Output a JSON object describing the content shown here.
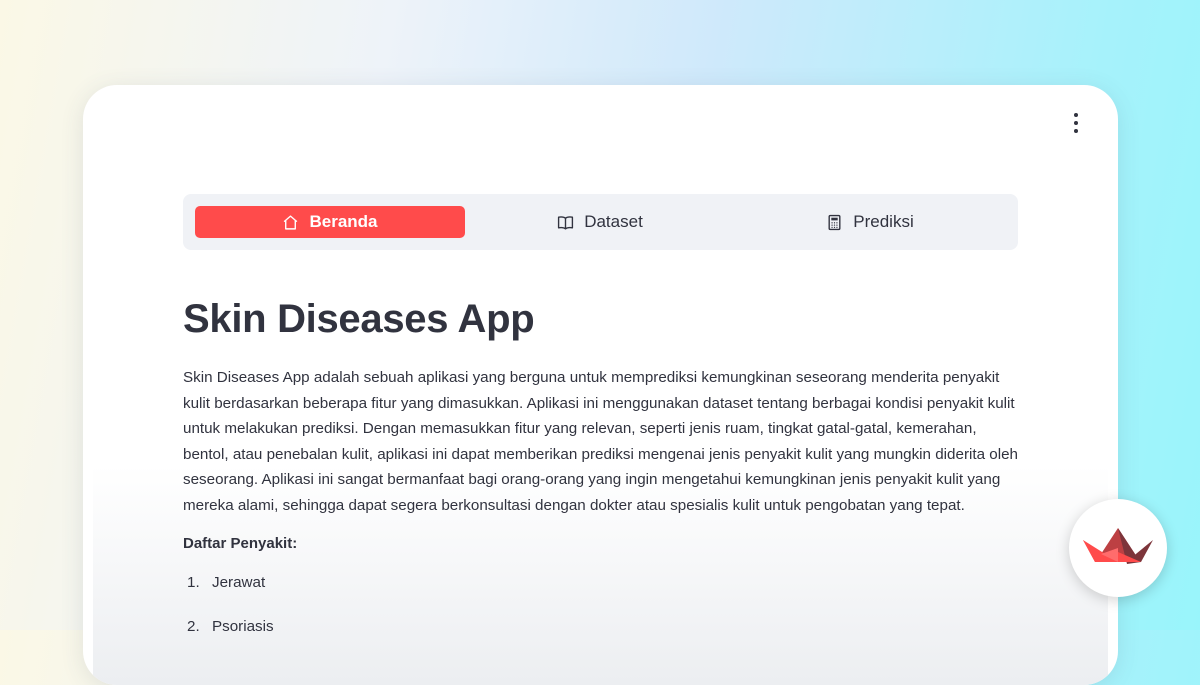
{
  "nav": {
    "items": [
      {
        "label": "Beranda",
        "icon": "house-icon",
        "active": true
      },
      {
        "label": "Dataset",
        "icon": "book-icon",
        "active": false
      },
      {
        "label": "Prediksi",
        "icon": "calculator-icon",
        "active": false
      }
    ]
  },
  "main": {
    "title": "Skin Diseases App",
    "intro": "Skin Diseases App adalah sebuah aplikasi yang berguna untuk memprediksi kemungkinan seseorang menderita penyakit kulit berdasarkan beberapa fitur yang dimasukkan. Aplikasi ini menggunakan dataset tentang berbagai kondisi penyakit kulit untuk melakukan prediksi. Dengan memasukkan fitur yang relevan, seperti jenis ruam, tingkat gatal-gatal, kemerahan, bentol, atau penebalan kulit, aplikasi ini dapat memberikan prediksi mengenai jenis penyakit kulit yang mungkin diderita oleh seseorang. Aplikasi ini sangat bermanfaat bagi orang-orang yang ingin mengetahui kemungkinan jenis penyakit kulit yang mereka alami, sehingga dapat segera berkonsultasi dengan dokter atau spesialis kulit untuk pengobatan yang tepat.",
    "list_heading": "Daftar Penyakit:",
    "diseases": [
      {
        "num": "1.",
        "name": "Jerawat"
      },
      {
        "num": "2.",
        "name": "Psoriasis"
      }
    ]
  },
  "colors": {
    "accent": "#ff4b4b",
    "text": "#31333f",
    "nav_bg": "#f0f2f6"
  },
  "fab": {
    "icon": "streamlit-crown-icon"
  },
  "menu": {
    "icon": "kebab-menu-icon"
  }
}
